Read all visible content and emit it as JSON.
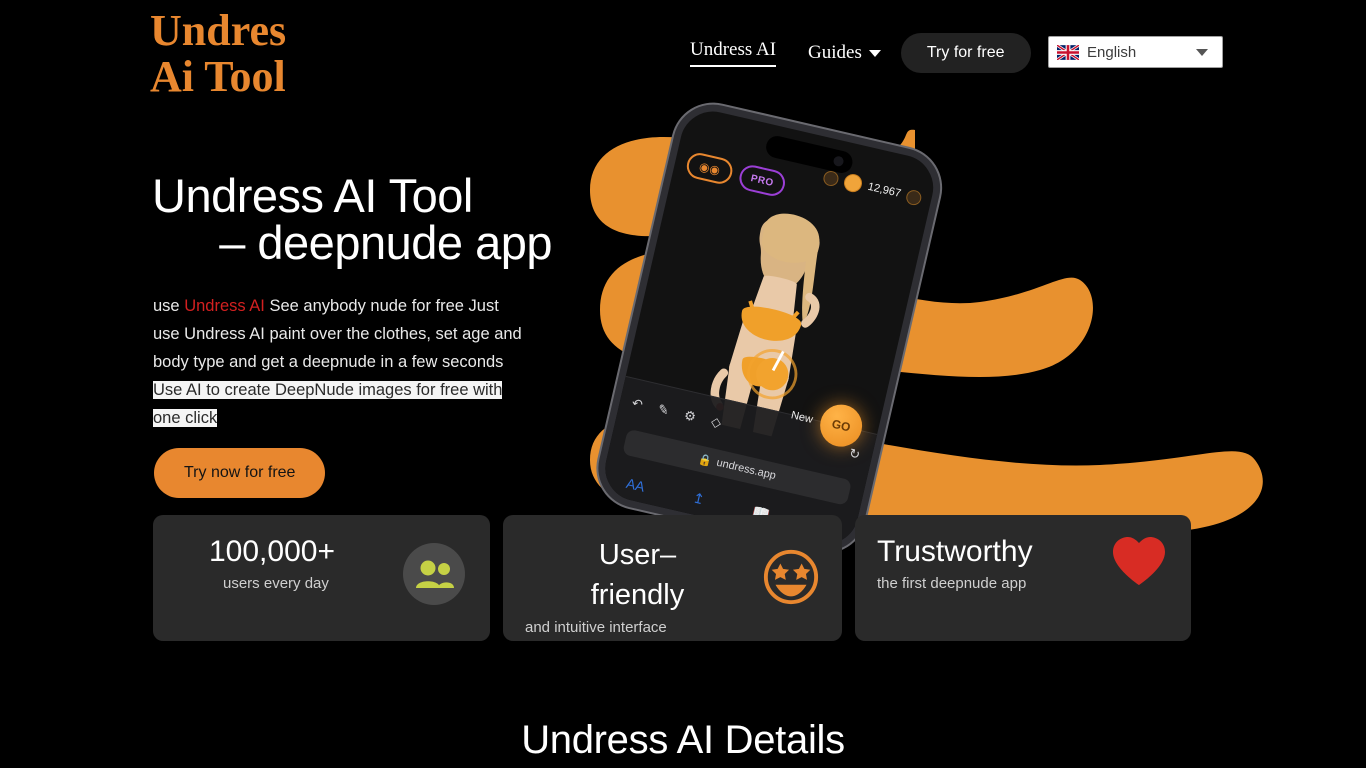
{
  "header": {
    "logo_line1": "Undres",
    "logo_line2": "Ai Tool",
    "nav": {
      "undress_ai": "Undress AI",
      "guides": "Guides",
      "try_for_free": "Try for free"
    },
    "language": {
      "selected": "English",
      "flag_icon": "uk-flag-icon",
      "caret_icon": "chevron-down-icon"
    }
  },
  "hero": {
    "title_line1": "Undress AI Tool",
    "title_line2": "– deepnude app",
    "paragraph": {
      "t1": "use ",
      "brand": "Undress AI",
      "t2": " See anybody nude for free Just use Undress AI paint over the clothes, set age and body type and get a deepnude in a few seconds ",
      "highlighted": "Use AI to create DeepNude images for free with one click"
    },
    "cta_label": "Try now for free"
  },
  "phone": {
    "pro_badge": "PRO",
    "coin_count": "12,967",
    "go_label": "GO",
    "new_label": "New",
    "url": "undress.app",
    "lock_icon": "lock-icon"
  },
  "cards": [
    {
      "title": "100,000+",
      "subtitle": "users every day",
      "icon": "people-icon",
      "icon_color": "#c5d145",
      "circle_color": "#4a4a4a"
    },
    {
      "title_line1": "User–",
      "title_line2": "friendly",
      "subtitle": "and intuitive interface",
      "icon": "star-struck-face-icon",
      "icon_color": "#e8872f"
    },
    {
      "title": "Trustworthy",
      "subtitle": "the first deepnude app",
      "icon": "heart-icon",
      "icon_color": "#d82c24"
    }
  ],
  "section": {
    "details_title": "Undress AI Details"
  },
  "colors": {
    "background": "#000000",
    "accent_orange": "#e8872f",
    "card_bg": "#2a2a2a",
    "brand_red": "#d32020",
    "highlight_bg": "#f5f5f5"
  }
}
